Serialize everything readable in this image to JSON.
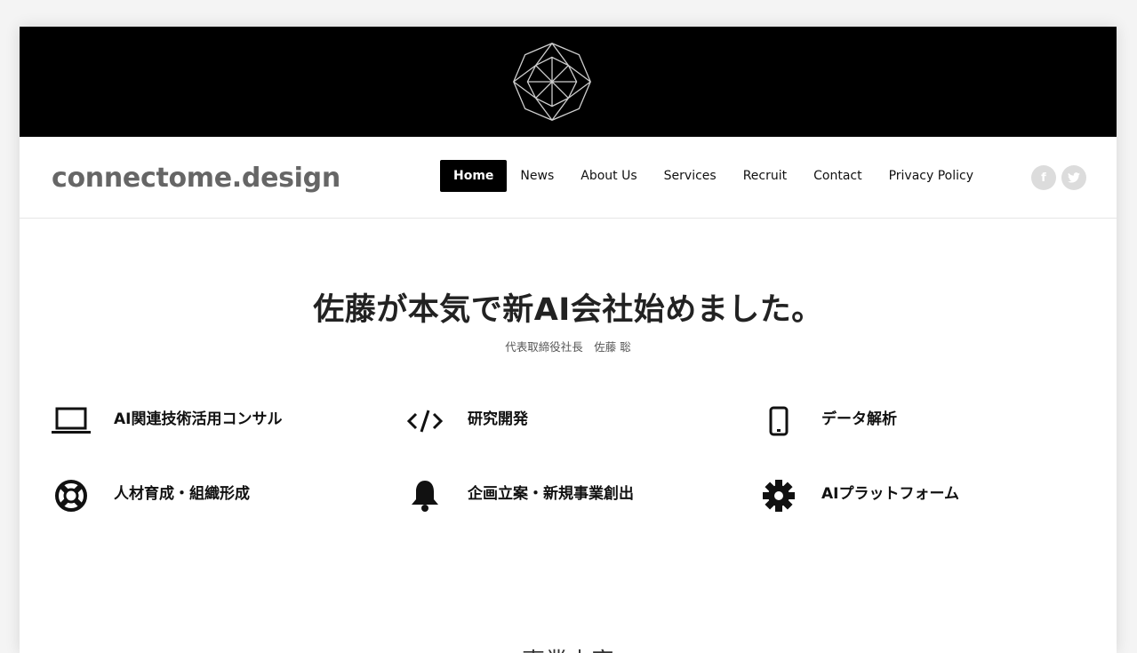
{
  "header": {
    "site_title": "connectome.design",
    "logo_icon": "geometric-crystal-logo"
  },
  "nav": {
    "items": [
      {
        "label": "Home",
        "active": true
      },
      {
        "label": "News",
        "active": false
      },
      {
        "label": "About Us",
        "active": false
      },
      {
        "label": "Services",
        "active": false
      },
      {
        "label": "Recruit",
        "active": false
      },
      {
        "label": "Contact",
        "active": false
      },
      {
        "label": "Privacy Policy",
        "active": false
      }
    ]
  },
  "social": {
    "facebook": "f",
    "twitter_icon": "twitter-bird-icon"
  },
  "main": {
    "headline": "佐藤が本気で新AI会社始めました。",
    "byline": "代表取締役社長　佐藤 聡"
  },
  "features": [
    {
      "icon": "laptop-icon",
      "label": "AI関連技術活用コンサル"
    },
    {
      "icon": "code-icon",
      "label": "研究開発"
    },
    {
      "icon": "mobile-phone-icon",
      "label": "データ解析"
    },
    {
      "icon": "lifebuoy-icon",
      "label": "人材育成・組織形成"
    },
    {
      "icon": "bell-icon",
      "label": "企画立案・新規事業創出"
    },
    {
      "icon": "gear-icon",
      "label": "AIプラットフォーム"
    }
  ],
  "next_section": {
    "title": "事業内容"
  },
  "colors": {
    "hero_background": "#000000",
    "title_gray": "#666666",
    "nav_active_bg": "#000000",
    "social_gray": "#dcdcdc"
  }
}
